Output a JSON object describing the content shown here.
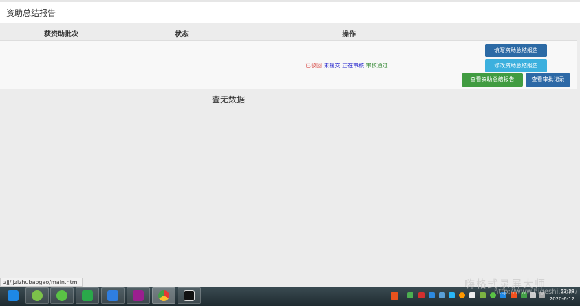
{
  "page": {
    "title": "资助总结报告"
  },
  "table": {
    "headers": [
      "获资助批次",
      "状态",
      "操作"
    ],
    "status_legend": [
      {
        "label": "已驳回",
        "color": "#d9534f"
      },
      {
        "label": "未提交",
        "color": "#2222cc"
      },
      {
        "label": "正在审核",
        "color": "#2222cc"
      },
      {
        "label": "审核通过",
        "color": "#3c8d3c"
      }
    ],
    "buttons": {
      "write": "填写资助总结报告",
      "edit": "修改资助总结报告",
      "view": "查看资助总结报告",
      "records": "查看审批记录"
    },
    "empty": "查无数据"
  },
  "statusbar": {
    "url": "zjj/jjzizhubaogao/main.html"
  },
  "taskbar": {
    "time": "23:38",
    "date": "2020-6-12"
  },
  "watermark": {
    "name": "嗨格式录屏大师",
    "url": "http://www.higeshi.com/"
  }
}
